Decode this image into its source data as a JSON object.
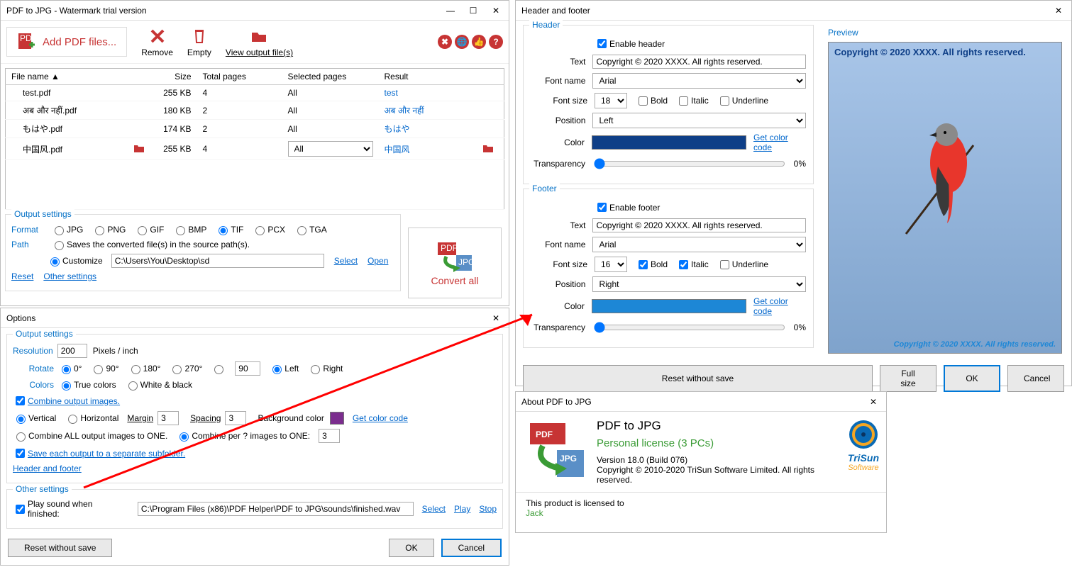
{
  "main": {
    "title": "PDF to JPG - Watermark trial version",
    "toolbar": {
      "add": "Add PDF files...",
      "remove": "Remove",
      "empty": "Empty",
      "view": "View output file(s)"
    },
    "cols": {
      "name": "File name ▲",
      "size": "Size",
      "total": "Total pages",
      "sel": "Selected pages",
      "res": "Result"
    },
    "rows": [
      {
        "name": "test.pdf",
        "size": "255 KB",
        "total": "4",
        "sel": "All",
        "res": "test"
      },
      {
        "name": "अब और नहीं.pdf",
        "size": "180 KB",
        "total": "2",
        "sel": "All",
        "res": "अब और नहीं"
      },
      {
        "name": "もはや.pdf",
        "size": "174 KB",
        "total": "2",
        "sel": "All",
        "res": "もはや"
      },
      {
        "name": "中国风.pdf",
        "size": "255 KB",
        "total": "4",
        "sel": "All",
        "res": "中国风"
      }
    ],
    "out": {
      "title": "Output settings",
      "format_lbl": "Format",
      "formats": [
        "JPG",
        "PNG",
        "GIF",
        "BMP",
        "TIF",
        "PCX",
        "TGA"
      ],
      "selected_format": "TIF",
      "path_lbl": "Path",
      "saves": "Saves the converted file(s) in the source path(s).",
      "customize": "Customize",
      "path": "C:\\Users\\You\\Desktop\\sd",
      "select": "Select",
      "open": "Open",
      "reset": "Reset",
      "other": "Other settings",
      "convert": "Convert all"
    }
  },
  "options": {
    "title": "Options",
    "out_title": "Output settings",
    "res_lbl": "Resolution",
    "res_val": "200",
    "res_unit": "Pixels / inch",
    "rot_lbl": "Rotate",
    "rot_opts": [
      "0°",
      "90°",
      "180°",
      "270°"
    ],
    "rot_custom": "90",
    "rot_left": "Left",
    "rot_right": "Right",
    "col_lbl": "Colors",
    "true_c": "True colors",
    "wb": "White & black",
    "combine": "Combine output images.",
    "vert": "Vertical",
    "horiz": "Horizontal",
    "margin_lbl": "Margin",
    "margin": "3",
    "spacing_lbl": "Spacing",
    "spacing": "3",
    "bg_lbl": "Background color",
    "get_color": "Get color code",
    "combine_all": "Combine ALL output images to ONE.",
    "combine_per": "Combine per ? images to ONE:",
    "per_val": "3",
    "save_sub": "Save each output to a separate subfolder.",
    "hf_link": "Header and footer",
    "other_title": "Other settings",
    "play_sound": "Play sound when finished:",
    "sound_path": "C:\\Program Files (x86)\\PDF Helper\\PDF to JPG\\sounds\\finished.wav",
    "sound_select": "Select",
    "sound_play": "Play",
    "sound_stop": "Stop",
    "reset_btn": "Reset without save",
    "ok": "OK",
    "cancel": "Cancel"
  },
  "hf": {
    "title": "Header and footer",
    "header_title": "Header",
    "footer_title": "Footer",
    "enable_h": "Enable header",
    "enable_f": "Enable footer",
    "text_lbl": "Text",
    "text_val": "Copyright © 2020 XXXX. All rights reserved.",
    "font_lbl": "Font name",
    "font_val": "Arial",
    "size_lbl": "Font size",
    "h_size": "18",
    "f_size": "16",
    "bold": "Bold",
    "italic": "Italic",
    "under": "Underline",
    "pos_lbl": "Position",
    "h_pos": "Left",
    "f_pos": "Right",
    "color_lbl": "Color",
    "get_color": "Get color code",
    "trans_lbl": "Transparency",
    "trans_val": "0%",
    "reset": "Reset without save",
    "fullsize": "Full size",
    "ok": "OK",
    "cancel": "Cancel",
    "preview_title": "Preview",
    "preview_header": "Copyright © 2020 XXXX. All rights reserved.",
    "preview_footer": "Copyright © 2020 XXXX. All rights reserved."
  },
  "about": {
    "title": "About PDF to JPG",
    "name": "PDF to JPG",
    "license": "Personal license (3 PCs)",
    "ver": "Version 18.0 (Build 076)",
    "copy": "Copyright © 2010-2020 TriSun Software Limited. All rights reserved.",
    "lic_to": "This product is licensed to",
    "user": "Jack",
    "brand": "TriSun",
    "brand2": "Software"
  }
}
